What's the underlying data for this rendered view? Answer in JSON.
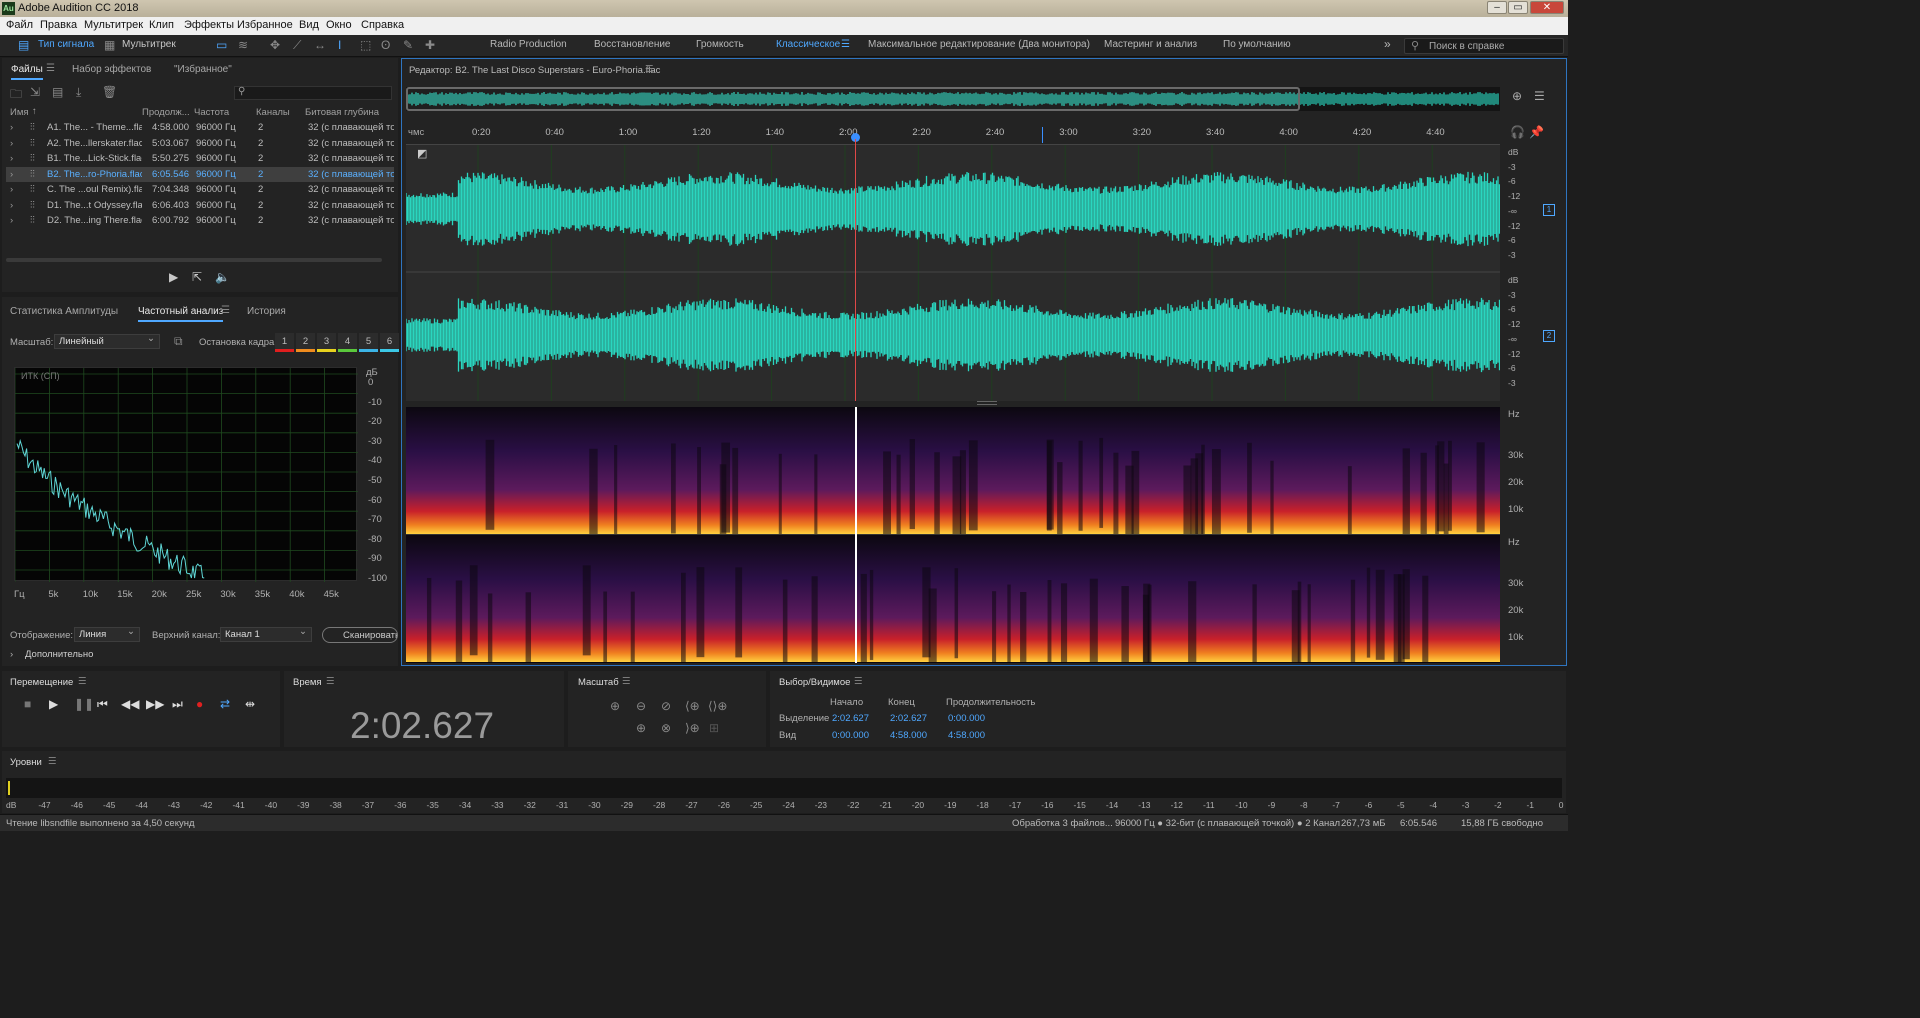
{
  "app": {
    "logo": "Au",
    "title": "Adobe Audition CC 2018"
  },
  "window_buttons": [
    "–",
    "▭",
    "✕"
  ],
  "menu": [
    "Файл",
    "Правка",
    "Мультитрек",
    "Клип",
    "Эффекты",
    "Избранное",
    "Вид",
    "Окно",
    "Справка"
  ],
  "toolbar": {
    "waveform_mode": "Тип сигнала",
    "multitrack_mode": "Мультитрек",
    "workspaces": [
      "Radio Production",
      "Восстановление",
      "Громкость",
      "Классическое",
      "Максимальное редактирование (Два монитора)",
      "Мастеринг и анализ",
      "По умолчанию"
    ],
    "active_workspace": "Классическое",
    "overflow": "»",
    "search_placeholder": "Поиск в справке"
  },
  "files_panel": {
    "tabs": [
      "Файлы",
      "Набор эффектов",
      "\"Избранное\""
    ],
    "search_icon": "⚲",
    "columns": [
      "Имя",
      "Продолж...",
      "Частота",
      "Каналы",
      "Битовая глубина"
    ],
    "sort_arrow": "↑",
    "rows": [
      {
        "name": "A1. The... - Theme...flac",
        "duration": "4:58.000",
        "rate": "96000 Гц",
        "channels": "2",
        "depth": "32 (с плавающей точ"
      },
      {
        "name": "A2. The...llerskater.flac",
        "duration": "5:03.067",
        "rate": "96000 Гц",
        "channels": "2",
        "depth": "32 (с плавающей точ"
      },
      {
        "name": "B1. The...Lick-Stick.flac",
        "duration": "5:50.275",
        "rate": "96000 Гц",
        "channels": "2",
        "depth": "32 (с плавающей точ"
      },
      {
        "name": "B2. The...ro-Phoria.flac",
        "duration": "6:05.546",
        "rate": "96000 Гц",
        "channels": "2",
        "depth": "32 (с плавающей точ",
        "selected": true
      },
      {
        "name": "C. The ...oul Remix).flac",
        "duration": "7:04.348",
        "rate": "96000 Гц",
        "channels": "2",
        "depth": "32 (с плавающей точ"
      },
      {
        "name": "D1. The...t Odyssey.flac",
        "duration": "6:06.403",
        "rate": "96000 Гц",
        "channels": "2",
        "depth": "32 (с плавающей точ"
      },
      {
        "name": "D2. The...ing There.flac",
        "duration": "6:00.792",
        "rate": "96000 Гц",
        "channels": "2",
        "depth": "32 (с плавающей точ"
      }
    ]
  },
  "analysis_panel": {
    "tabs": [
      "Статистика Амплитуды",
      "Частотный анализ",
      "История"
    ],
    "scale_label": "Масштаб:",
    "scale_value": "Линейный",
    "freeze_label": "Остановка кадра:",
    "freeze_slots": [
      "1",
      "2",
      "3",
      "4",
      "5",
      "6"
    ],
    "freeze_colors": [
      "#e01e1e",
      "#f08c1e",
      "#e8d21e",
      "#5ac83c",
      "#3cb4e6",
      "#3cc8e6"
    ],
    "graph_label": "ИТК (СП)",
    "db_unit": "дБ",
    "db_ticks": [
      "0",
      "-10",
      "-20",
      "-30",
      "-40",
      "-50",
      "-60",
      "-70",
      "-80",
      "-90",
      "-100"
    ],
    "freq_ticks": [
      "Гц",
      "5k",
      "10k",
      "15k",
      "20k",
      "25k",
      "30k",
      "35k",
      "40k",
      "45k"
    ],
    "display_label": "Отображение:",
    "display_value": "Линия",
    "channel_label": "Верхний канал:",
    "channel_value": "Канал 1",
    "scan_button": "Сканировать",
    "advanced": "Дополнительно"
  },
  "editor": {
    "title": "Редактор: B2. The Last Disco Superstars - Euro-Phoria.flac",
    "ruler_unit": "чмс",
    "ruler_ticks": [
      "0:20",
      "0:40",
      "1:00",
      "1:20",
      "1:40",
      "2:00",
      "2:20",
      "2:40",
      "3:00",
      "3:20",
      "3:40",
      "4:00",
      "4:20",
      "4:40"
    ],
    "db_scale": [
      "dB",
      "-3",
      "-6",
      "-12",
      "-∞",
      "-12",
      "-6",
      "-3"
    ],
    "channel_badges": [
      "1",
      "2"
    ],
    "hz_label": "Hz",
    "hz_ticks": [
      "30k",
      "20k",
      "10k"
    ],
    "accent": "#2ad6bf"
  },
  "transport": {
    "title": "Перемещение"
  },
  "time": {
    "title": "Время",
    "value": "2:02.627"
  },
  "zoom": {
    "title": "Масштаб"
  },
  "selection": {
    "title": "Выбор/Видимое",
    "headers": [
      "Начало",
      "Конец",
      "Продолжительность"
    ],
    "rows": [
      {
        "label": "Выделение",
        "start": "2:02.627",
        "end": "2:02.627",
        "duration": "0:00.000"
      },
      {
        "label": "Вид",
        "start": "0:00.000",
        "end": "4:58.000",
        "duration": "4:58.000"
      }
    ]
  },
  "levels": {
    "title": "Уровни",
    "ticks": [
      "dB",
      "-47",
      "-46",
      "-45",
      "-44",
      "-43",
      "-42",
      "-41",
      "-40",
      "-39",
      "-38",
      "-37",
      "-36",
      "-35",
      "-34",
      "-33",
      "-32",
      "-31",
      "-30",
      "-29",
      "-28",
      "-27",
      "-26",
      "-25",
      "-24",
      "-23",
      "-22",
      "-21",
      "-20",
      "-19",
      "-18",
      "-17",
      "-16",
      "-15",
      "-14",
      "-13",
      "-12",
      "-11",
      "-10",
      "-9",
      "-8",
      "-7",
      "-6",
      "-5",
      "-4",
      "-3",
      "-2",
      "-1",
      "0"
    ]
  },
  "status": {
    "left": "Чтение libsndfile выполнено за 4,50 секунд",
    "processing": "Обработка 3 файлов...",
    "format": "96000 Гц ● 32-бит (с плавающей точкой) ● 2 Канал",
    "size": "267,73 мБ",
    "duration": "6:05.546",
    "free": "15,88 ГБ свободно"
  }
}
